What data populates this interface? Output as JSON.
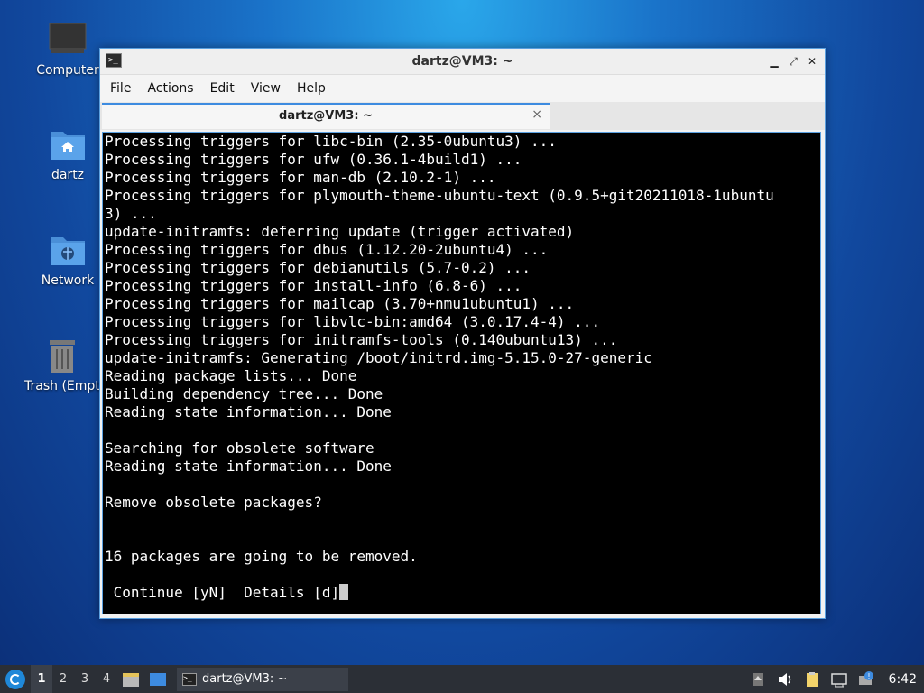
{
  "desktop": {
    "icons": [
      {
        "label": "Computer"
      },
      {
        "label": "dartz"
      },
      {
        "label": "Network"
      },
      {
        "label": "Trash (Empt"
      }
    ]
  },
  "window": {
    "title": "dartz@VM3: ~",
    "menu": [
      "File",
      "Actions",
      "Edit",
      "View",
      "Help"
    ],
    "tab_title": "dartz@VM3: ~",
    "close_glyph": "×"
  },
  "terminal": {
    "lines": [
      "Processing triggers for libc-bin (2.35-0ubuntu3) ...",
      "Processing triggers for ufw (0.36.1-4build1) ...",
      "Processing triggers for man-db (2.10.2-1) ...",
      "Processing triggers for plymouth-theme-ubuntu-text (0.9.5+git20211018-1ubuntu",
      "3) ...",
      "update-initramfs: deferring update (trigger activated)",
      "Processing triggers for dbus (1.12.20-2ubuntu4) ...",
      "Processing triggers for debianutils (5.7-0.2) ...",
      "Processing triggers for install-info (6.8-6) ...",
      "Processing triggers for mailcap (3.70+nmu1ubuntu1) ...",
      "Processing triggers for libvlc-bin:amd64 (3.0.17.4-4) ...",
      "Processing triggers for initramfs-tools (0.140ubuntu13) ...",
      "update-initramfs: Generating /boot/initrd.img-5.15.0-27-generic",
      "Reading package lists... Done",
      "Building dependency tree... Done",
      "Reading state information... Done",
      "",
      "Searching for obsolete software",
      "Reading state information... Done",
      "",
      "Remove obsolete packages?",
      "",
      "",
      "16 packages are going to be removed.",
      ""
    ],
    "prompt": " Continue [yN]  Details [d]"
  },
  "taskbar": {
    "workspaces": [
      "1",
      "2",
      "3",
      "4"
    ],
    "task_label": "dartz@VM3: ~",
    "clock": "6:42"
  },
  "colors": {
    "accent": "#3d8be0",
    "terminal_bg": "#000000",
    "taskbar_bg": "#2b2f36"
  }
}
